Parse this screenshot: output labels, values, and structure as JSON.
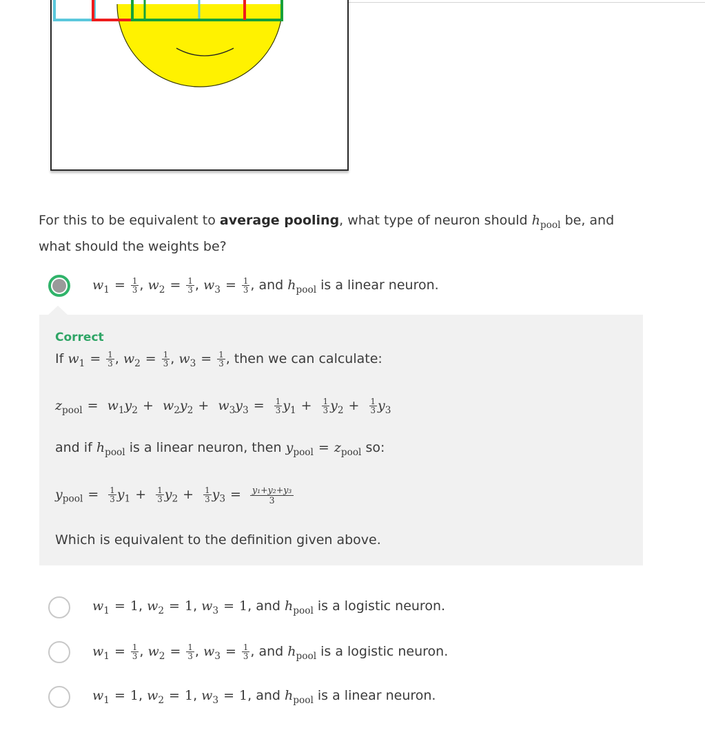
{
  "question": {
    "prefix": "For this to be equivalent to",
    "bold": "average pooling",
    "middle": ", what type of neuron should",
    "h_var": "h",
    "pool_sub": "pool",
    "suffix": "be, and what should the weights be?"
  },
  "options": [
    {
      "w_value": "1/3",
      "text_prefix": ", and",
      "text_suffix": "is a linear neuron.",
      "selected": true
    },
    {
      "w_value": "1",
      "text_prefix": ", and",
      "text_suffix": "is a logistic neuron.",
      "selected": false
    },
    {
      "w_value": "1/3",
      "text_prefix": ", and",
      "text_suffix": "is a logistic neuron.",
      "selected": false
    },
    {
      "w_value": "1",
      "text_prefix": ", and",
      "text_suffix": "is a linear neuron.",
      "selected": false
    }
  ],
  "feedback": {
    "status": "Correct",
    "line1_prefix": "If",
    "line1_suffix": ", then we can calculate:",
    "line3_prefix": "and if",
    "line3_middle": "is a linear neuron, then",
    "line3_suffix": "so:",
    "sum_numerator": "y₁+y₂+y₃",
    "sum_denominator": "3",
    "conclusion": "Which is equivalent to the definition given above."
  },
  "colors": {
    "accent_correct": "#2fa566",
    "radio_selected_ring": "#30b36a",
    "feedback_bg": "#f1f1f1",
    "face_yellow": "#fff200",
    "square_cyan": "#5bc8dc",
    "square_red": "#ee1c1c",
    "square_green": "#16a13a"
  }
}
